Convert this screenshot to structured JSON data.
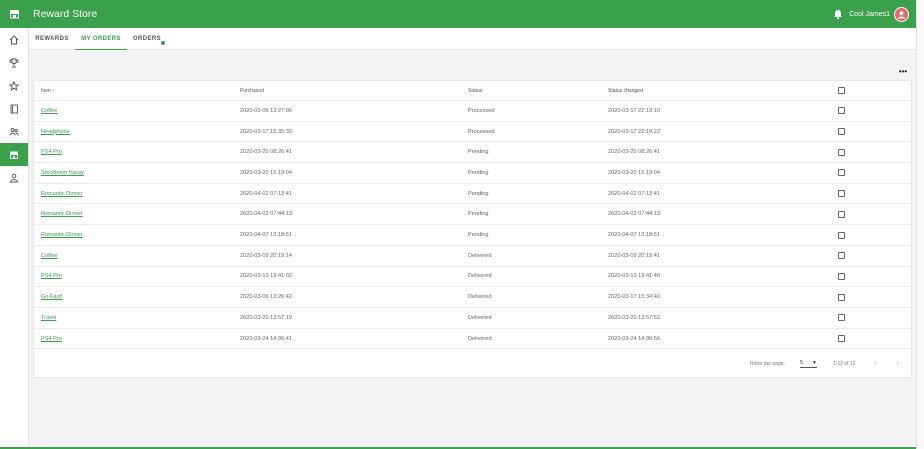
{
  "app": {
    "title": "Reward Store",
    "menu_icon": "storefront-icon",
    "user_name": "Cool James1",
    "notification_icon": "bell-icon",
    "accent_color": "#3aa04b"
  },
  "sidebar": {
    "items": [
      {
        "icon": "home-icon",
        "active": false
      },
      {
        "icon": "trophy-icon",
        "active": false
      },
      {
        "icon": "star-icon",
        "active": false
      },
      {
        "icon": "book-icon",
        "active": false
      },
      {
        "icon": "team-icon",
        "active": false
      },
      {
        "icon": "store-icon",
        "active": true
      },
      {
        "icon": "person-icon",
        "active": false
      }
    ]
  },
  "tabs": [
    {
      "label": "REWARDS",
      "active": false
    },
    {
      "label": "MY ORDERS",
      "active": true
    },
    {
      "label": "ORDERS",
      "active": false,
      "badge": true
    }
  ],
  "table": {
    "headers": {
      "item": "Item ↑",
      "purchased": "Purchased",
      "status": "Status",
      "status_changed": "Status changed"
    },
    "rows": [
      {
        "item": "Coffee",
        "purchased": "2020-03-06 13:27:06",
        "status": "Processed",
        "changed": "2020-03-17 22:19:10"
      },
      {
        "item": "Headphone",
        "purchased": "2020-03-17 15:35:39",
        "status": "Processed",
        "changed": "2020-03-17 22:19:22"
      },
      {
        "item": "PS4 Pro",
        "purchased": "2020-03-20 08:26:41",
        "status": "Pending",
        "changed": "2020-03-20 08:26:41"
      },
      {
        "item": "Stockholm Vacay",
        "purchased": "2020-03-20 15:19:04",
        "status": "Pending",
        "changed": "2020-03-20 15:19:04"
      },
      {
        "item": "Romantic Dinner",
        "purchased": "2020-04-02 07:12:41",
        "status": "Pending",
        "changed": "2020-04-02 07:12:41"
      },
      {
        "item": "Romantic Dinner",
        "purchased": "2020-04-03 07:44:13",
        "status": "Pending",
        "changed": "2020-04-03 07:44:13"
      },
      {
        "item": "Romantic Dinner",
        "purchased": "2020-04-07 13:18:51",
        "status": "Pending",
        "changed": "2020-04-07 13:18:51"
      },
      {
        "item": "Coffee",
        "purchased": "2020-03-09 20:19:14",
        "status": "Delivered",
        "changed": "2020-03-09 20:19:41"
      },
      {
        "item": "PS4 Pro",
        "purchased": "2020-03-13 13:41:02",
        "status": "Delivered",
        "changed": "2020-03-13 13:41:40"
      },
      {
        "item": "Go Fast!",
        "purchased": "2020-03-06 13:26:42",
        "status": "Delivered",
        "changed": "2020-03-17 15:34:40"
      },
      {
        "item": "Travel",
        "purchased": "2020-03-20 13:57:19",
        "status": "Delivered",
        "changed": "2020-03-20 13:57:52"
      },
      {
        "item": "PS4 Pro",
        "purchased": "2020-03-24 14:36:41",
        "status": "Delivered",
        "changed": "2020-03-24 14:36:56"
      }
    ]
  },
  "pagination": {
    "rows_per_page_label": "Rows per page:",
    "rows_per_page_value": "5",
    "range_text": "1-12 of 12",
    "prev_icon": "chevron-left-icon",
    "next_icon": "chevron-right-icon"
  }
}
